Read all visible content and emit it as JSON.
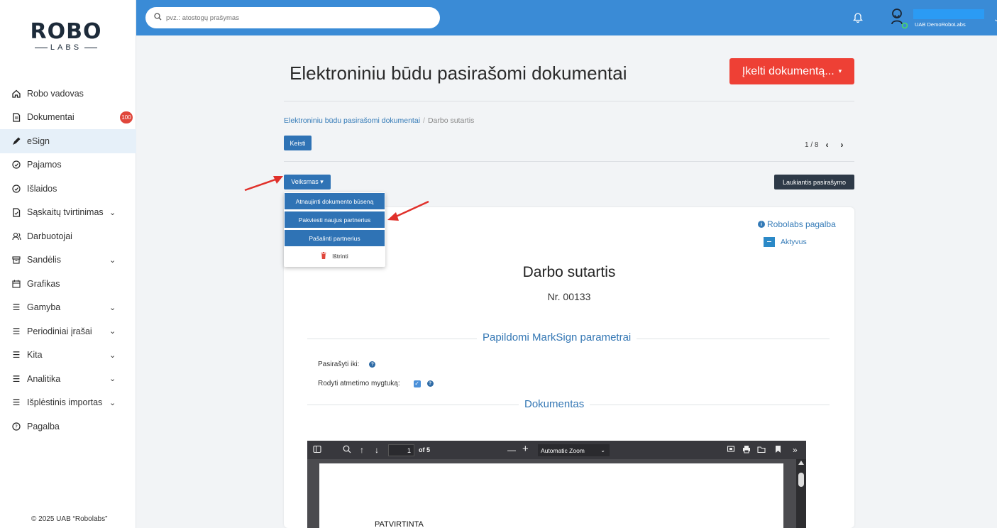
{
  "sidebar": {
    "logo_top": "ROBO",
    "logo_bottom": "LABS",
    "items": [
      {
        "label": "Robo vadovas",
        "icon": "home-icon"
      },
      {
        "label": "Dokumentai",
        "icon": "document-icon",
        "badge": "100"
      },
      {
        "label": "eSign",
        "icon": "pen-icon",
        "active": true
      },
      {
        "label": "Pajamos",
        "icon": "income-icon"
      },
      {
        "label": "Išlaidos",
        "icon": "expense-icon"
      },
      {
        "label": "Sąskaitų tvirtinimas",
        "icon": "invoice-icon",
        "expandable": true
      },
      {
        "label": "Darbuotojai",
        "icon": "people-icon"
      },
      {
        "label": "Sandėlis",
        "icon": "warehouse-icon",
        "expandable": true
      },
      {
        "label": "Grafikas",
        "icon": "calendar-icon"
      },
      {
        "label": "Gamyba",
        "icon": "list-icon",
        "expandable": true
      },
      {
        "label": "Periodiniai įrašai",
        "icon": "list-icon",
        "expandable": true
      },
      {
        "label": "Kita",
        "icon": "list-icon",
        "expandable": true
      },
      {
        "label": "Analitika",
        "icon": "list-icon",
        "expandable": true
      },
      {
        "label": "Išplėstinis importas",
        "icon": "list-icon",
        "expandable": true
      },
      {
        "label": "Pagalba",
        "icon": "help-circle-icon"
      }
    ],
    "copyright": "© 2025 UAB “Robolabs”"
  },
  "topbar": {
    "search_placeholder": "pvz.: atostogų prašymas",
    "user_name": "UAB DemoRoboLabs",
    "accent_color": "#3a8bd6"
  },
  "header": {
    "title": "Elektroniniu būdu pasirašomi dokumentai",
    "upload_label": "Įkelti dokumentą..."
  },
  "breadcrumb": {
    "parent": "Elektroniniu būdu pasirašomi dokumentai",
    "separator": "/",
    "current": "Darbo sutartis"
  },
  "toolbar": {
    "edit_label": "Keisti",
    "pager_text": "1 / 8",
    "actions_label": "Veiksmas",
    "status_label": "Laukiantis pasirašymo"
  },
  "dropdown": {
    "items": [
      "Atnaujinti dokumento būseną",
      "Pakviesti naujus partnerius",
      "Pašalinti partnerius",
      "Ištrinti"
    ]
  },
  "document": {
    "help_link": "Robolabs pagalba",
    "status": "Aktyvus",
    "title": "Darbo sutartis",
    "number": "Nr. 00133",
    "section_params": "Papildomi MarkSign parametrai",
    "sign_until_label": "Pasirašyti iki:",
    "show_reject_label": "Rodyti atmetimo mygtuką:",
    "show_reject_checked": true,
    "section_document": "Dokumentas"
  },
  "pdf_viewer": {
    "page_value": "1",
    "page_of": "of 5",
    "zoom": "Automatic Zoom",
    "page_text": "PATVIRTINTA"
  },
  "colors": {
    "primary_button": "#2f73b5",
    "danger_button": "#ee4035",
    "dark_button": "#2e3a48",
    "annotation_arrow": "#e0302a"
  }
}
